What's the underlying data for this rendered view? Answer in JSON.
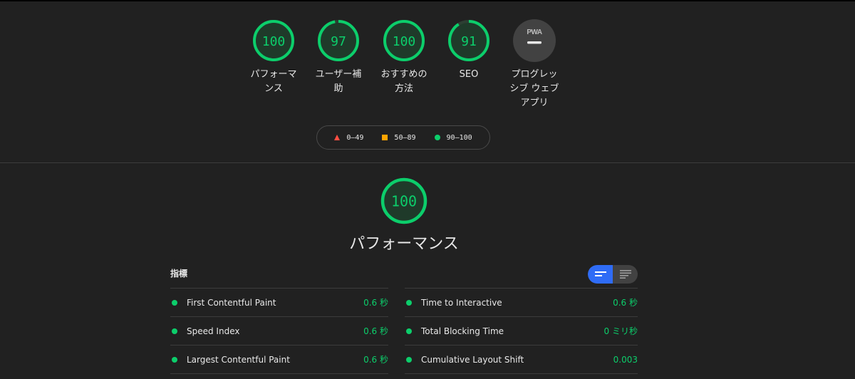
{
  "categories": [
    {
      "score": "100",
      "label": "パフォーマンス",
      "label_lines": [
        "パフォーマ",
        "ンス"
      ]
    },
    {
      "score": "97",
      "label": "ユーザー補助",
      "label_lines": [
        "ユーザー補",
        "助"
      ]
    },
    {
      "score": "100",
      "label": "おすすめの方法",
      "label_lines": [
        "おすすめの",
        "方法"
      ]
    },
    {
      "score": "91",
      "label": "SEO",
      "label_lines": [
        "SEO"
      ]
    },
    {
      "score": "—",
      "badge": "PWA",
      "label": "プログレッシブ ウェブ アプリ",
      "label_lines": [
        "プログレッ",
        "シブ ウェブ",
        "アプリ"
      ]
    }
  ],
  "legend": {
    "fail": "0–49",
    "average": "50–89",
    "pass": "90–100"
  },
  "performance": {
    "score": "100",
    "title": "パフォーマンス"
  },
  "metrics": {
    "header": "指標",
    "left": [
      {
        "name": "First Contentful Paint",
        "value": "0.6 秒"
      },
      {
        "name": "Speed Index",
        "value": "0.6 秒"
      },
      {
        "name": "Largest Contentful Paint",
        "value": "0.6 秒"
      }
    ],
    "right": [
      {
        "name": "Time to Interactive",
        "value": "0.6 秒"
      },
      {
        "name": "Total Blocking Time",
        "value": "0 ミリ秒"
      },
      {
        "name": "Cumulative Layout Shift",
        "value": "0.003"
      }
    ]
  },
  "colors": {
    "pass": "#0cce6b",
    "average": "#ffa400",
    "fail": "#ff4e42",
    "toggle_active": "#2f6cf6",
    "background": "#212121"
  },
  "icons": {
    "toggle_compact": "compact-view-icon",
    "toggle_expanded": "expanded-view-icon",
    "pwa": "pwa-badge-icon"
  }
}
